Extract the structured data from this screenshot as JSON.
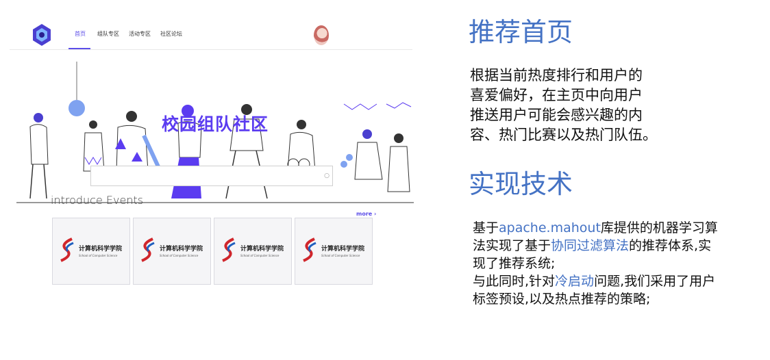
{
  "site": {
    "nav": [
      "首页",
      "组队专区",
      "活动专区",
      "社区论坛"
    ],
    "hero_title": "校园组队社区",
    "events_title": "introduce Events",
    "more_label": "more",
    "cards": [
      {
        "name": "计算机科学学院",
        "sub": "School of Computer Science"
      },
      {
        "name": "计算机科学学院",
        "sub": "School of Computer Science"
      },
      {
        "name": "计算机科学学院",
        "sub": "School of Computer Science"
      },
      {
        "name": "计算机科学学院",
        "sub": "School of Computer Science"
      }
    ]
  },
  "section1": {
    "heading": "推荐首页",
    "lines": [
      "根据当前热度排行和用户的",
      "喜爱偏好，在主页中向用户",
      "推送用户可能会感兴趣的内",
      "容、热门比赛以及热门队伍。"
    ]
  },
  "section2": {
    "heading": "实现技术",
    "l1a": "基于",
    "l1b": "apache.mahout",
    "l1c": "库提供的机器学习算",
    "l2a": "法实现了基于",
    "l2b": "协同过滤算法",
    "l2c": "的推荐体系,实",
    "l3": "现了推荐系统;",
    "l4a": "与此同时,针对",
    "l4b": "冷启动",
    "l4c": "问题,我们采用了用户",
    "l5": "标签预设,以及热点推荐的策略;"
  },
  "colors": {
    "accent": "#4472c4",
    "brand": "#5b3cf0"
  }
}
